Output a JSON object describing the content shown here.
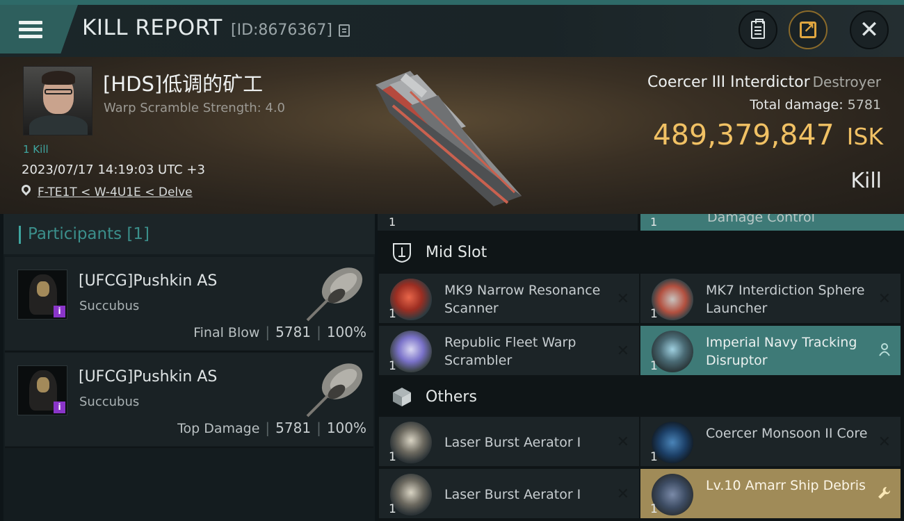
{
  "header": {
    "title": "KILL REPORT",
    "report_id": "[ID:8676367]",
    "icons": [
      "menu-icon",
      "copy-icon",
      "clipboard-icon",
      "share-icon",
      "close-icon"
    ]
  },
  "victim": {
    "pilot_name": "[HDS]低调的矿工",
    "warp_scramble": "Warp Scramble Strength: 4.0",
    "kill_count": "1 Kill",
    "date": "2023/07/17 14:19:03 UTC +3",
    "location": "F-TE1T < W-4U1E < Delve",
    "ship_name": "Coercer III Interdictor",
    "ship_class": "Destroyer",
    "total_damage_label": "Total damage:",
    "total_damage_value": "5781",
    "isk_value": "489,379,847",
    "isk_unit": "ISK",
    "result": "Kill"
  },
  "participants": {
    "label": "Participants",
    "count": "[1]",
    "cards": [
      {
        "name": "[UFCG]Pushkin AS",
        "ship": "Succubus",
        "role": "Final Blow",
        "damage": "5781",
        "percent": "100%"
      },
      {
        "name": "[UFCG]Pushkin AS",
        "ship": "Succubus",
        "role": "Top Damage",
        "damage": "5781",
        "percent": "100%"
      }
    ]
  },
  "fittings": {
    "top_row": {
      "left_qty": "1",
      "right_qty": "1",
      "right_name": "Damage Control"
    },
    "mid_slot": {
      "title": "Mid Slot",
      "items": [
        {
          "qty": "1",
          "name": "MK9 Narrow Resonance Scanner",
          "status": "destroyed"
        },
        {
          "qty": "1",
          "name": "MK7 Interdiction Sphere Launcher",
          "status": "destroyed"
        },
        {
          "qty": "1",
          "name": "Republic Fleet Warp Scrambler",
          "status": "destroyed"
        },
        {
          "qty": "1",
          "name": "Imperial Navy Tracking Disruptor",
          "status": "dropped"
        }
      ]
    },
    "others": {
      "title": "Others",
      "items": [
        {
          "qty": "1",
          "name": "Laser Burst Aerator I",
          "status": "destroyed"
        },
        {
          "qty": "1",
          "name": "Coercer Monsoon II Core",
          "status": "destroyed"
        },
        {
          "qty": "1",
          "name": "Laser Burst Aerator I",
          "status": "destroyed"
        },
        {
          "qty": "1",
          "name": "Lv.10 Amarr Ship Debris",
          "status": "salvage"
        }
      ]
    }
  },
  "colors": {
    "accent_teal": "#3e7a77",
    "isk_gold": "#f1c164",
    "salvage_gold": "#a08b58"
  }
}
